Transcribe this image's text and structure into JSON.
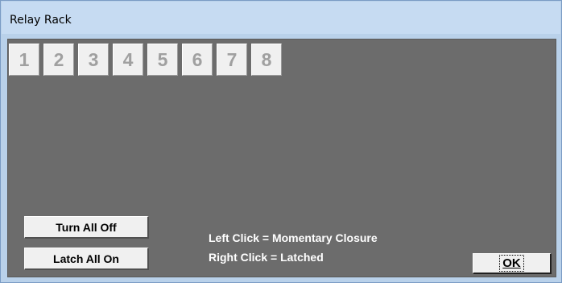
{
  "window": {
    "title": "Relay Rack"
  },
  "relays": [
    {
      "label": "1"
    },
    {
      "label": "2"
    },
    {
      "label": "3"
    },
    {
      "label": "4"
    },
    {
      "label": "5"
    },
    {
      "label": "6"
    },
    {
      "label": "7"
    },
    {
      "label": "8"
    }
  ],
  "controls": {
    "turn_all_off_label": "Turn All Off",
    "latch_all_on_label": "Latch All On",
    "ok_label": "OK"
  },
  "help": {
    "left_click": "Left Click = Momentary Closure",
    "right_click": "Right Click = Latched"
  },
  "colors": {
    "panel_background": "#6c6c6c",
    "title_bar": "#c6dbf2",
    "relay_button_face": "#f0f0f0",
    "relay_label": "#a0a0a0",
    "help_text": "#ffffff"
  }
}
